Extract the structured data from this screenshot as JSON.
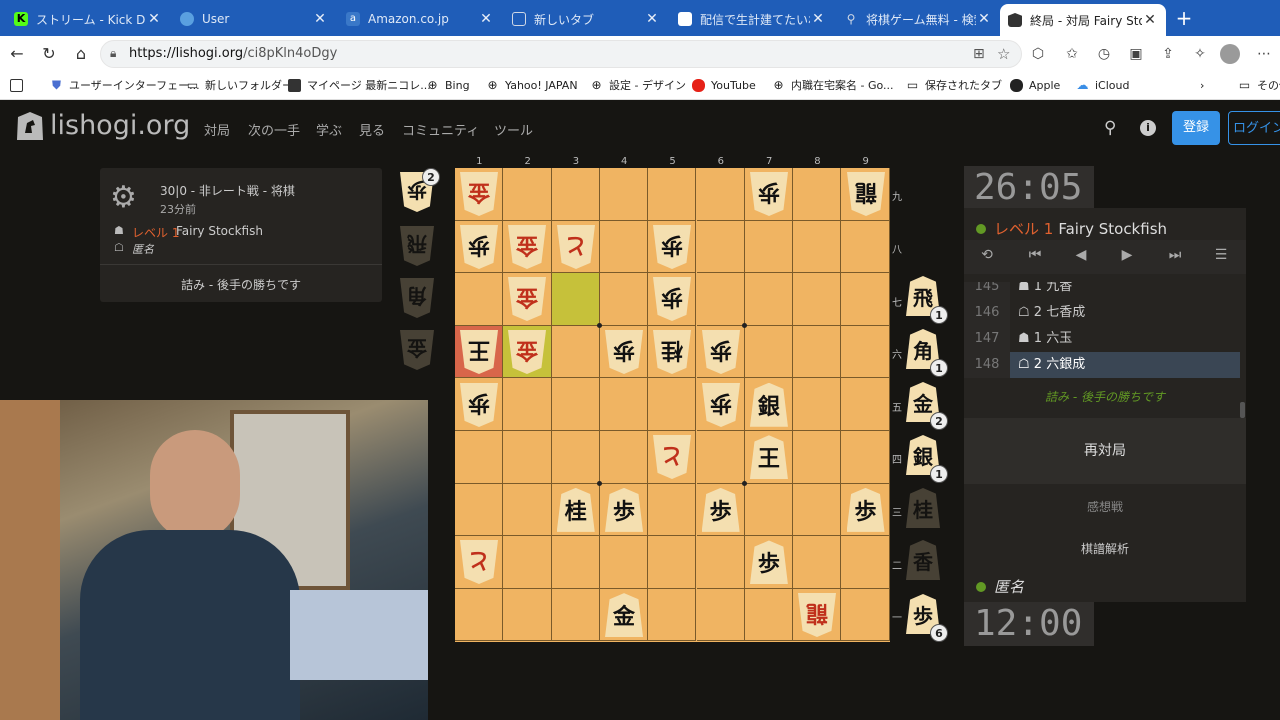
{
  "browser": {
    "tabs": [
      {
        "title": "ストリーム - Kick Dashboar",
        "icon": "kick-icon",
        "color": "#53fc18"
      },
      {
        "title": "User",
        "icon": "user-icon",
        "color": "#5aa0e0"
      },
      {
        "title": "Amazon.co.jp",
        "icon": "amazon-icon",
        "color": "#3a78c8"
      },
      {
        "title": "新しいタブ",
        "icon": "newtab-icon",
        "color": "#cfd8e6"
      },
      {
        "title": "配信で生計建てたいわかっ",
        "icon": "doc-icon",
        "color": "#ffffff"
      },
      {
        "title": "将棋ゲーム無料 - 検索",
        "icon": "search-icon",
        "color": "#cfd8e6"
      },
      {
        "title": "終局 - 対局 Fairy Stockfis",
        "icon": "lishogi-icon",
        "color": "#333333"
      }
    ],
    "url_host": "https://lishogi.org",
    "url_path": "/ci8pKln4oDgy",
    "bookmarks": [
      "ユーザーインターフェー...",
      "新しいフォルダー",
      "マイページ 最新ニコレ...",
      "Bing",
      "Yahoo! JAPAN",
      "設定 - デザイン",
      "YouTube",
      "内職在宅案名 - Go...",
      "保存されたタブ",
      "Apple",
      "iCloud",
      "その他"
    ]
  },
  "site": {
    "logo": "lishogi.org",
    "nav": [
      "対局",
      "次の一手",
      "学ぶ",
      "見る",
      "コミュニティ",
      "ツール"
    ],
    "signup": "登録",
    "login": "ログイン"
  },
  "game": {
    "mode": "30|0 - 非レート戦 - 将棋",
    "ago": "23分前",
    "sente_level": "レベル 1",
    "sente_name": "Fairy Stockfish",
    "gote_name": "匿名",
    "status": "詰み - 後手の勝ちです"
  },
  "board": {
    "files": [
      "1",
      "2",
      "3",
      "4",
      "5",
      "6",
      "7",
      "8",
      "9"
    ],
    "ranks": [
      "九",
      "八",
      "七",
      "六",
      "五",
      "四",
      "三",
      "二",
      "一"
    ]
  },
  "top_hand": {
    "piece": "歩",
    "count": "2"
  },
  "right_hand": [
    {
      "piece": "飛",
      "count": "1"
    },
    {
      "piece": "角",
      "count": "1"
    },
    {
      "piece": "金",
      "count": "2"
    },
    {
      "piece": "銀",
      "count": "1"
    },
    {
      "piece": "歩",
      "count": "6"
    }
  ],
  "clocks": {
    "top": "26:05",
    "bottom": "12:00"
  },
  "panel": {
    "opponent_level": "レベル 1",
    "opponent_name": "Fairy Stockfish",
    "player_name": "匿名",
    "moves": [
      {
        "no": "145",
        "text": "☗ 1 九香"
      },
      {
        "no": "146",
        "text": "☖ 2 七香成"
      },
      {
        "no": "147",
        "text": "☗ 1 六玉"
      },
      {
        "no": "148",
        "text": "☖ 2 六銀成"
      }
    ],
    "result": "詰み - 後手の勝ちです",
    "rematch": "再対局",
    "feedback": "感想戦",
    "analysis": "棋譜解析"
  },
  "colors": {
    "accent": "#629924",
    "board": "#f0b462",
    "signup": "#3692e7"
  }
}
